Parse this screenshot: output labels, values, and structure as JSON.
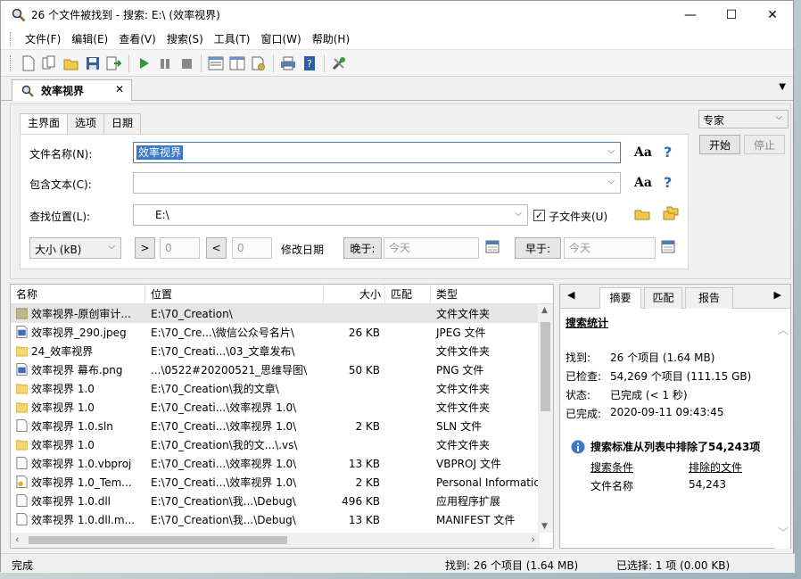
{
  "window": {
    "title": "26 个文件被找到 - 搜索: E:\\ (效率视界)",
    "minimize": "—",
    "maximize": "☐",
    "close": "✕"
  },
  "menu": [
    "文件(F)",
    "编辑(E)",
    "查看(V)",
    "搜索(S)",
    "工具(T)",
    "窗口(W)",
    "帮助(H)"
  ],
  "doc_tab": {
    "label": "效率视界",
    "close": "✕"
  },
  "search": {
    "tabs": [
      "主界面",
      "选项",
      "日期"
    ],
    "filename_label": "文件名称(N):",
    "filename_value": "效率视界",
    "contains_label": "包含文本(C):",
    "contains_value": "",
    "location_label": "查找位置(L):",
    "location_value": "E:\\",
    "subfolders_label": "子文件夹(U)",
    "subfolders_checked": true,
    "size_unit": "大小 (kB)",
    "gt": ">",
    "gt_value": "0",
    "lt": "<",
    "lt_value": "0",
    "modified_label": "修改日期",
    "later_label": "晚于:",
    "later_value": "今天",
    "earlier_label": "早于:",
    "earlier_value": "今天",
    "aa": "Aa",
    "help": "?",
    "mode": "专家",
    "start": "开始",
    "stop": "停止"
  },
  "results": {
    "columns": [
      "名称",
      "位置",
      "大小",
      "匹配",
      "类型"
    ],
    "rows": [
      {
        "name": "效率视界-原创审计...",
        "location": "E:\\70_Creation\\",
        "size": "",
        "type": "文件文件夹",
        "icon": "folder-special",
        "selected": true
      },
      {
        "name": "效率视界_290.jpeg",
        "location": "E:\\70_Cre...\\微信公众号名片\\",
        "size": "26 KB",
        "type": "JPEG 文件",
        "icon": "image"
      },
      {
        "name": "24_效率视界",
        "location": "E:\\70_Creati...\\03_文章发布\\",
        "size": "",
        "type": "文件文件夹",
        "icon": "folder"
      },
      {
        "name": "效率视界 幕布.png",
        "location": "...\\0522#20200521_思维导图\\",
        "size": "50 KB",
        "type": "PNG 文件",
        "icon": "image"
      },
      {
        "name": "效率视界 1.0",
        "location": "E:\\70_Creation\\我的文章\\",
        "size": "",
        "type": "文件文件夹",
        "icon": "folder"
      },
      {
        "name": "效率视界 1.0",
        "location": "E:\\70_Creati...\\效率视界 1.0\\",
        "size": "",
        "type": "文件文件夹",
        "icon": "folder"
      },
      {
        "name": "效率视界 1.0.sln",
        "location": "E:\\70_Creati...\\效率视界 1.0\\",
        "size": "2 KB",
        "type": "SLN 文件",
        "icon": "file"
      },
      {
        "name": "效率视界 1.0",
        "location": "E:\\70_Creation\\我的文...\\.vs\\",
        "size": "",
        "type": "文件文件夹",
        "icon": "folder"
      },
      {
        "name": "效率视界 1.0.vbproj",
        "location": "E:\\70_Creati...\\效率视界 1.0\\",
        "size": "13 KB",
        "type": "VBPROJ 文件",
        "icon": "file"
      },
      {
        "name": "效率视界 1.0_Tem...",
        "location": "E:\\70_Creati...\\效率视界 1.0\\",
        "size": "2 KB",
        "type": "Personal Informatic",
        "icon": "pfx"
      },
      {
        "name": "效率视界 1.0.dll",
        "location": "E:\\70_Creation\\我...\\Debug\\",
        "size": "496 KB",
        "type": "应用程序扩展",
        "icon": "file"
      },
      {
        "name": "效率视界 1.0.dll.m...",
        "location": "E:\\70_Creation\\我...\\Debug\\",
        "size": "13 KB",
        "type": "MANIFEST 文件",
        "icon": "file"
      }
    ]
  },
  "summary": {
    "tabs": [
      "摘要",
      "匹配",
      "报告"
    ],
    "heading": "搜索统计",
    "stats": [
      {
        "label": "找到:",
        "value": "26 个项目 (1.64 MB)"
      },
      {
        "label": "已检查:",
        "value": "54,269 个项目 (111.15 GB)"
      },
      {
        "label": "状态:",
        "value": "已完成 (< 1 秒)"
      },
      {
        "label": "已完成:",
        "value": "2020-09-11 09:43:45"
      }
    ],
    "excluded_heading": "搜索标准从列表中排除了54,243项",
    "excluded_col1": "搜索条件",
    "excluded_col2": "排除的文件",
    "excluded_row_label": "文件名称",
    "excluded_row_value": "54,243"
  },
  "status": {
    "left": "完成",
    "found": "找到: 26 个项目 (1.64 MB)",
    "selected": "已选择: 1 项 (0.00 KB)"
  }
}
